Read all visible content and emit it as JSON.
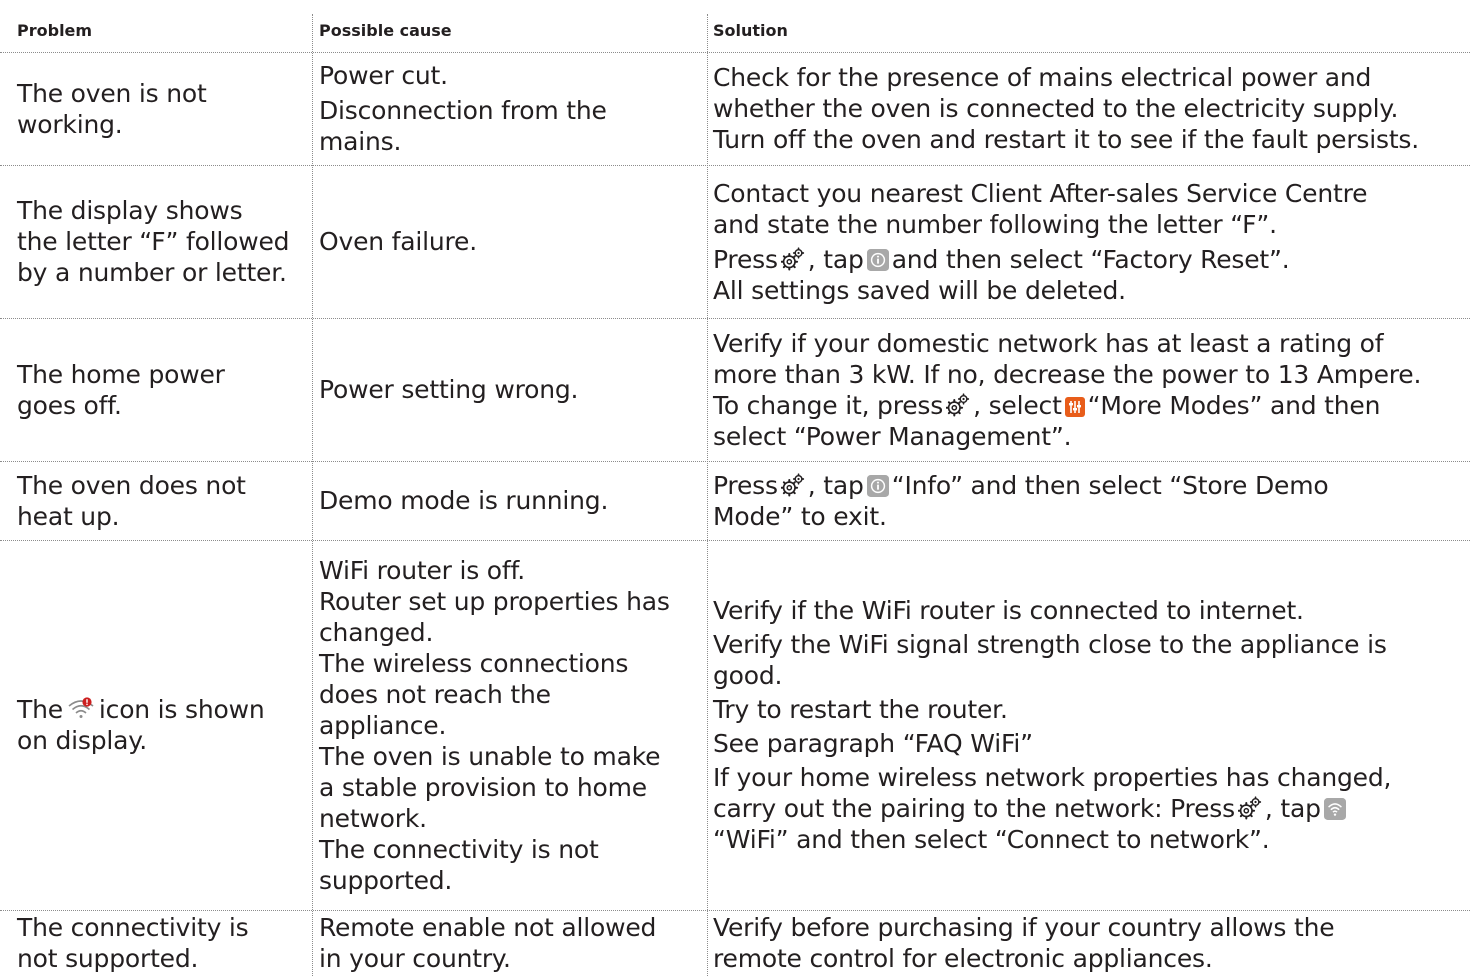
{
  "headers": {
    "problem": "Problem",
    "cause": "Possible cause",
    "solution": "Solution"
  },
  "colors": {
    "text": "#231f20",
    "info_icon_bg": "#a8a8a8",
    "mode_icon_bg": "#e85d1a",
    "wifi_error_dot": "#cc1f1f",
    "separator": "#8c8c8c"
  },
  "rows": [
    {
      "problem": [
        "The oven is not",
        "working."
      ],
      "cause": [
        "Power cut.",
        "Disconnection from the",
        "mains."
      ],
      "solution": [
        "Check for the presence of mains electrical power and",
        "whether the oven is connected to the electricity supply.",
        "Turn off the oven and restart it to see if the fault persists."
      ]
    },
    {
      "problem": [
        "The display shows",
        "the letter “F” followed",
        "by a number or letter."
      ],
      "cause": [
        "Oven failure."
      ],
      "solution": {
        "l1": "Contact you nearest Client After-sales Service Centre",
        "l2": "and state the number following the letter “F”.",
        "l3a": "Press",
        "l3b": ", tap",
        "l3c": "and then select “Factory Reset”.",
        "l4": "All settings saved will be deleted."
      }
    },
    {
      "problem": [
        "The home power",
        "goes off."
      ],
      "cause": [
        "Power setting wrong."
      ],
      "solution": {
        "l1": "Verify if your domestic network has at least a rating of",
        "l2": "more than 3 kW. If no, decrease the power to 13 Ampere.",
        "l3a": "To change it, press",
        "l3b": ", select",
        "l3c": "“More Modes” and then",
        "l4": "select “Power Management”."
      }
    },
    {
      "problem": [
        "The oven does not",
        "heat up."
      ],
      "cause": [
        "Demo mode is running."
      ],
      "solution": {
        "l1a": "Press",
        "l1b": ", tap",
        "l1c": "“Info” and then select “Store Demo",
        "l2": "Mode” to exit."
      }
    },
    {
      "problem": {
        "a": "The",
        "b": "icon is shown",
        "c": "on display."
      },
      "cause": [
        "WiFi router is off.",
        "Router set up properties has",
        "changed.",
        "The wireless connections",
        "does not reach the",
        "appliance.",
        "The oven is unable to make",
        "a stable provision to home",
        "network.",
        "The connectivity is not",
        "supported."
      ],
      "solution": {
        "l1": "Verify if the WiFi router is connected to internet.",
        "l2": "Verify the WiFi signal strength close to the appliance is",
        "l3": "good.",
        "l4": "Try to restart the router.",
        "l5": "See paragraph “FAQ WiFi”",
        "l6": "If your home wireless network properties has changed,",
        "l7a": "carry out the pairing to the network: Press",
        "l7b": ", tap",
        "l8": "“WiFi” and then select “Connect to network”."
      }
    },
    {
      "problem": [
        "The connectivity is",
        "not supported."
      ],
      "cause": [
        "Remote enable not allowed",
        "in your country."
      ],
      "solution": [
        "Verify before purchasing if your country allows the",
        "remote control for electronic appliances."
      ]
    }
  ]
}
